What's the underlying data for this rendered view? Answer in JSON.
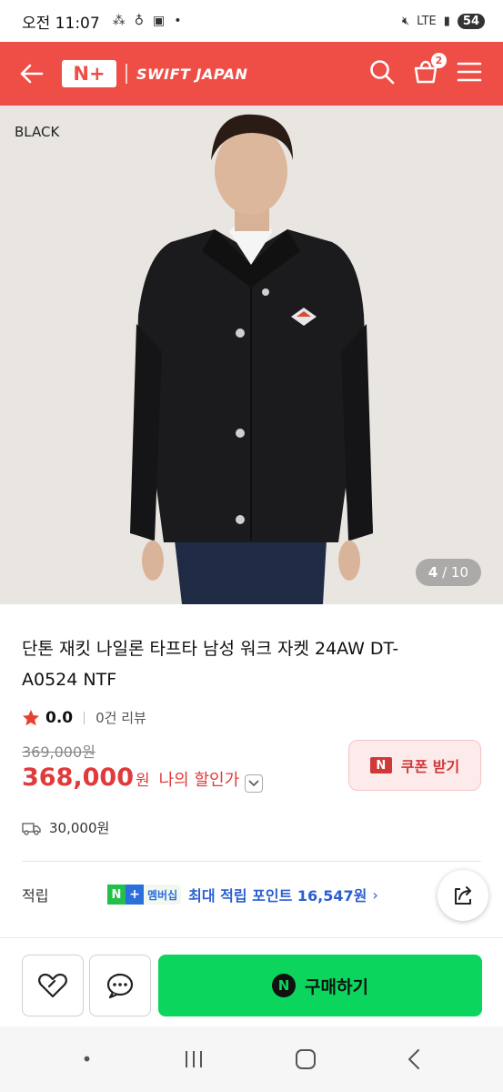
{
  "status_bar": {
    "time": "오전 11:07",
    "network": "LTE",
    "battery": "54"
  },
  "header": {
    "logo_text": "N+",
    "brand": "SWIFT JAPAN",
    "cart_count": "2"
  },
  "gallery": {
    "color_label": "BLACK",
    "current": "4",
    "total": "/ 10"
  },
  "product": {
    "title_line1": "단톤 재킷 나일론 타프타 남성 워크 자켓 24AW DT-",
    "title_line2": "A0524 NTF",
    "rating": "0.0",
    "reviews": "0건 리뷰",
    "original_price": "369,000원",
    "price": "368,000",
    "price_unit": "원",
    "my_price_label": "나의 할인가",
    "coupon_label": "쿠폰 받기",
    "shipping": "30,000원"
  },
  "points": {
    "label": "적립",
    "membership_badge": "멤버십",
    "text": "최대 적립 포인트 16,547원"
  },
  "bottom_bar": {
    "buy_label": "구매하기"
  },
  "colors": {
    "brand_red": "#ef4e47",
    "buy_green": "#0bd55c",
    "price_red": "#e03a3a",
    "points_blue": "#2b5fd0"
  }
}
